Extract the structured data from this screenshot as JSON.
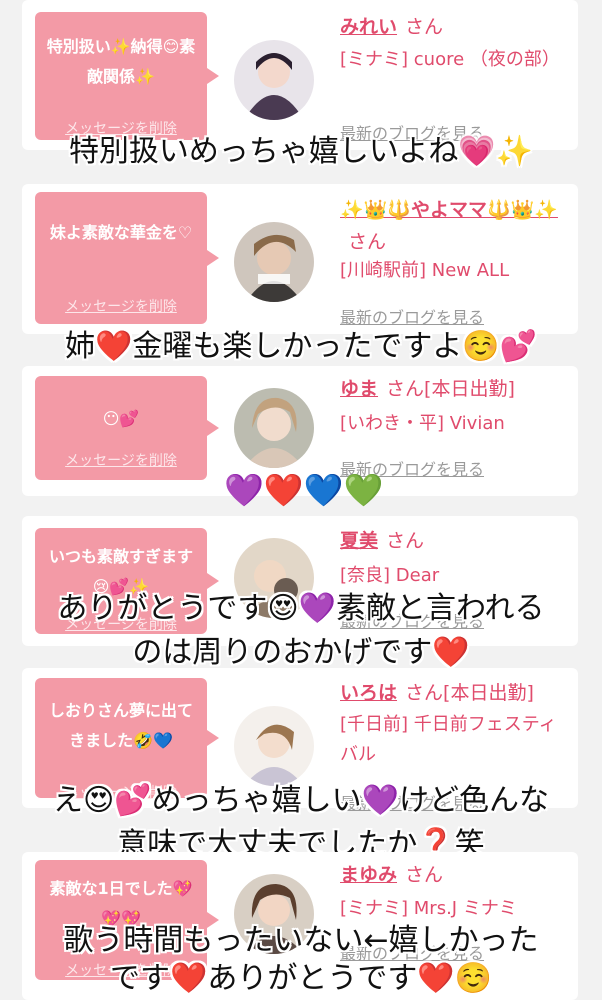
{
  "cards": [
    {
      "message": "特別扱い✨納得😊素敵関係✨",
      "delete_label": "メッセージを削除",
      "name": "みれい",
      "san": "さん",
      "status": "",
      "shop": "[ミナミ] cuore （夜の部）",
      "blog": "最新のブログを見る",
      "overlay": [
        "特別扱いめっちゃ嬉しいよね💗✨"
      ]
    },
    {
      "message": "妹よ素敵な華金を♡",
      "delete_label": "メッセージを削除",
      "name": "✨👑🔱やよママ🔱👑✨",
      "san": "さん",
      "status": "",
      "shop": "[川崎駅前] New ALL",
      "blog": "最新のブログを見る",
      "overlay": [
        "姉❤️金曜も楽しかったですよ☺️💕"
      ]
    },
    {
      "message": "😶💕",
      "delete_label": "メッセージを削除",
      "name": "ゆま",
      "san": "さん",
      "status": "[本日出勤]",
      "shop": "[いわき・平] Vivian",
      "blog": "最新のブログを見る",
      "overlay": []
    },
    {
      "message": "いつも素敵すぎます😢💕✨",
      "delete_label": "メッセージを削除",
      "name": "夏美",
      "san": "さん",
      "status": "",
      "shop": "[奈良] Dear",
      "blog": "最新のブログを見る",
      "overlay": [
        "ありがとうです😍💜素敵と言われる",
        "のは周りのおかげです❤️"
      ]
    },
    {
      "message": "しおりさん夢に出てきました🤣💙",
      "delete_label": "メッセージを削除",
      "name": "いろは",
      "san": "さん",
      "status": "[本日出勤]",
      "shop": "[千日前] 千日前フェスティバル",
      "blog": "最新のブログを見る",
      "overlay": [
        "え😍💕めっちゃ嬉しい💜けど色んな",
        "意味で大丈夫でしたか❓笑"
      ]
    },
    {
      "message": "素敵な1日でした💖💖💖",
      "delete_label": "メッセージを削除",
      "name": "まゆみ",
      "san": "さん",
      "status": "",
      "shop": "[ミナミ] Mrs.J ミナミ",
      "blog": "最新のブログを見る",
      "overlay": [
        "歌う時間もったいない←嬉しかった",
        "です❤️ありがとうです❤️☺️"
      ]
    }
  ],
  "hearts_overlay": "💜❤️💙💚",
  "colors": {
    "bubble": "#f39aa6",
    "name": "#e04b6c",
    "background": "#f2f2f2"
  }
}
